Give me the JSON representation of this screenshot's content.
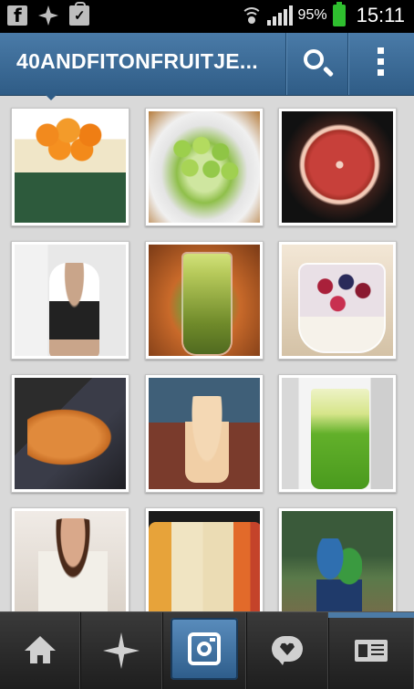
{
  "status_bar": {
    "battery_percent": "95%",
    "time": "15:11",
    "icons": [
      "facebook-icon",
      "pinwheel-icon",
      "shopping-bag-icon",
      "wifi-icon",
      "signal-icon",
      "battery-icon"
    ]
  },
  "action_bar": {
    "title": "40ANDFITONFRUITJE...",
    "buttons": [
      "search-icon",
      "overflow-menu-icon"
    ],
    "accent": "#3d6c97"
  },
  "photo_grid": {
    "columns": 3,
    "photos": [
      {
        "subject": "orange-box"
      },
      {
        "subject": "green-grapes"
      },
      {
        "subject": "blood-orange"
      },
      {
        "subject": "pregnant-woman"
      },
      {
        "subject": "green-juice"
      },
      {
        "subject": "berry-smoothie"
      },
      {
        "subject": "sleeping-cat"
      },
      {
        "subject": "kitten"
      },
      {
        "subject": "green-smoothie"
      },
      {
        "subject": "meditating-woman"
      },
      {
        "subject": "juice-bottles"
      },
      {
        "subject": "children-forest"
      }
    ]
  },
  "bottom_nav": {
    "items": [
      "home-icon",
      "explore-icon",
      "camera-icon",
      "news-icon",
      "profile-icon"
    ],
    "selected": "profile-icon",
    "selected_color": "#4c7ba6"
  }
}
